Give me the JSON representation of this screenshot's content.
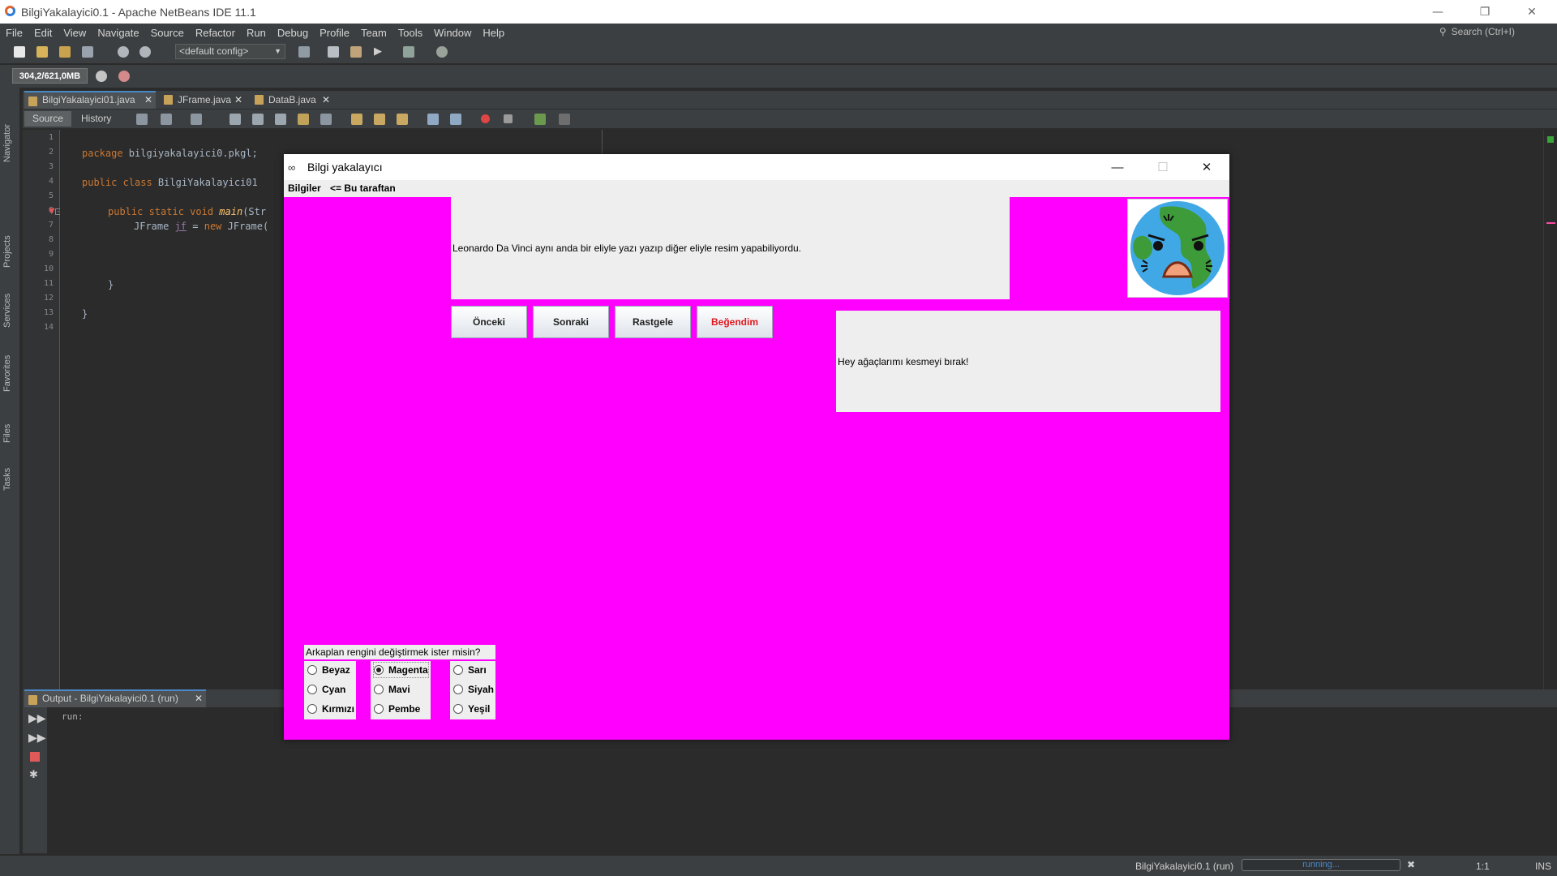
{
  "ide": {
    "title": "BilgiYakalayici0.1 - Apache NetBeans IDE 11.1",
    "menu": [
      "File",
      "Edit",
      "View",
      "Navigate",
      "Source",
      "Refactor",
      "Run",
      "Debug",
      "Profile",
      "Team",
      "Tools",
      "Window",
      "Help"
    ],
    "search_placeholder": "Search (Ctrl+I)",
    "config": "<default config>",
    "memory": "304,2/621,0MB",
    "side_tabs": [
      "Navigator",
      "Projects",
      "Services",
      "Favorites",
      "Files",
      "Tasks"
    ],
    "editor_tabs": [
      {
        "label": "BilgiYakalayici01.java"
      },
      {
        "label": "JFrame.java"
      },
      {
        "label": "DataB.java"
      }
    ],
    "source_label": "Source",
    "history_label": "History",
    "line_numbers": [
      "1",
      "2",
      "3",
      "4",
      "5",
      "6",
      "7",
      "8",
      "9",
      "10",
      "11",
      "12",
      "13",
      "14"
    ],
    "code": {
      "l2_kw": "package",
      "l2_rest": " bilgiyakalayici0.pkgl;",
      "l4_kw": "public class",
      "l4_rest": " BilgiYakalayici01",
      "l6_kw": "public static void",
      "l6_fn": "main",
      "l6_rest": "(Str",
      "l7_pre": "JFrame ",
      "l7_var": "jf",
      "l7_mid": " = ",
      "l7_kw": "new",
      "l7_rest": " JFrame(",
      "l11": "}",
      "l13": "}"
    },
    "output_tab": "Output - BilgiYakalayici0.1 (run)",
    "output_text": "run:",
    "status_project": "BilgiYakalayici0.1 (run)",
    "status_progress": "running...",
    "status_pos": "1:1",
    "status_mode": "INS"
  },
  "app": {
    "title": "Bilgi yakalayıcı",
    "menu_bilgiler": "Bilgiler",
    "menu_hint": "<= Bu taraftan",
    "info_text": "Leonardo Da Vinci aynı anda bir eliyle yazı yazıp diğer eliyle resim yapabiliyordu.",
    "buttons": [
      {
        "label": "Önceki"
      },
      {
        "label": "Sonraki"
      },
      {
        "label": "Rastgele"
      },
      {
        "label": "Beğendim",
        "color": "#e0181e"
      }
    ],
    "quote": "Hey ağaçlarımı kesmeyi bırak!",
    "bg_question": "Arkaplan rengini değiştirmek ister misin?",
    "colors": [
      [
        "Beyaz",
        "Cyan",
        "Kırmızı"
      ],
      [
        "Magenta",
        "Mavi",
        "Pembe"
      ],
      [
        "Sarı",
        "Siyah",
        "Yeşil"
      ]
    ],
    "selected_color": "Magenta",
    "background": "#ff00ff"
  }
}
